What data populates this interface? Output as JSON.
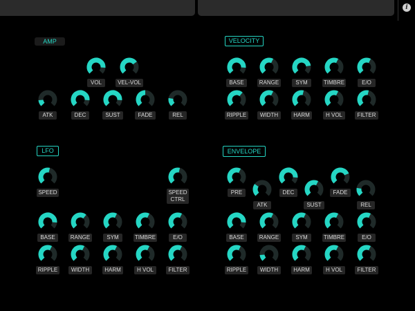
{
  "colors": {
    "accent": "#25d6c4",
    "track": "#1f2a29",
    "label_bg": "#262626",
    "label_text": "#dcdcdc"
  },
  "topbar": {
    "info_icon": "i"
  },
  "sections": {
    "amp": {
      "title": "AMP"
    },
    "velocity": {
      "title": "VELOCITY"
    },
    "lfo": {
      "title": "LFO"
    },
    "envelope": {
      "title": "ENVELOPE"
    }
  },
  "knobs": [
    {
      "label": "VOL",
      "value": 0.85
    },
    {
      "label": "VEL-VOL",
      "value": 0.7
    },
    {
      "label": "ATK",
      "value": 0.15
    },
    {
      "label": "DEC",
      "value": 0.85
    },
    {
      "label": "SUST",
      "value": 0.85
    },
    {
      "label": "FADE",
      "value": 0.5
    },
    {
      "label": "REL",
      "value": 0.2
    },
    {
      "label": "BASE",
      "value": 0.85
    },
    {
      "label": "RANGE",
      "value": 0.6
    },
    {
      "label": "SYM",
      "value": 0.8
    },
    {
      "label": "TIMBRE",
      "value": 0.6
    },
    {
      "label": "E/O",
      "value": 0.6
    },
    {
      "label": "RIPPLE",
      "value": 0.65
    },
    {
      "label": "WIDTH",
      "value": 0.6
    },
    {
      "label": "HARM",
      "value": 0.55
    },
    {
      "label": "H VOL",
      "value": 0.6
    },
    {
      "label": "FILTER",
      "value": 0.55
    },
    {
      "label": "SPEED",
      "value": 0.55
    },
    {
      "label": "SPEED\nCTRL",
      "value": 0.55
    },
    {
      "label": "BASE",
      "value": 0.85
    },
    {
      "label": "RANGE",
      "value": 0.65
    },
    {
      "label": "SYM",
      "value": 0.6
    },
    {
      "label": "TIMBRE",
      "value": 0.6
    },
    {
      "label": "E/O",
      "value": 0.6
    },
    {
      "label": "RIPPLE",
      "value": 0.6
    },
    {
      "label": "WIDTH",
      "value": 0.6
    },
    {
      "label": "HARM",
      "value": 0.6
    },
    {
      "label": "H VOL",
      "value": 0.6
    },
    {
      "label": "FILTER",
      "value": 0.6
    },
    {
      "label": "PRE",
      "value": 0.6
    },
    {
      "label": "ATK",
      "value": 0.3
    },
    {
      "label": "DEC",
      "value": 0.85
    },
    {
      "label": "SUST",
      "value": 0.6
    },
    {
      "label": "FADE",
      "value": 0.75
    },
    {
      "label": "REL",
      "value": 0.2
    },
    {
      "label": "BASE",
      "value": 0.85
    },
    {
      "label": "RANGE",
      "value": 0.6
    },
    {
      "label": "SYM",
      "value": 0.6
    },
    {
      "label": "TIMBRE",
      "value": 0.6
    },
    {
      "label": "E/O",
      "value": 0.6
    },
    {
      "label": "RIPPLE",
      "value": 0.6
    },
    {
      "label": "WIDTH",
      "value": 0.15
    },
    {
      "label": "HARM",
      "value": 0.6
    },
    {
      "label": "H VOL",
      "value": 0.6
    },
    {
      "label": "FILTER",
      "value": 0.6
    }
  ]
}
